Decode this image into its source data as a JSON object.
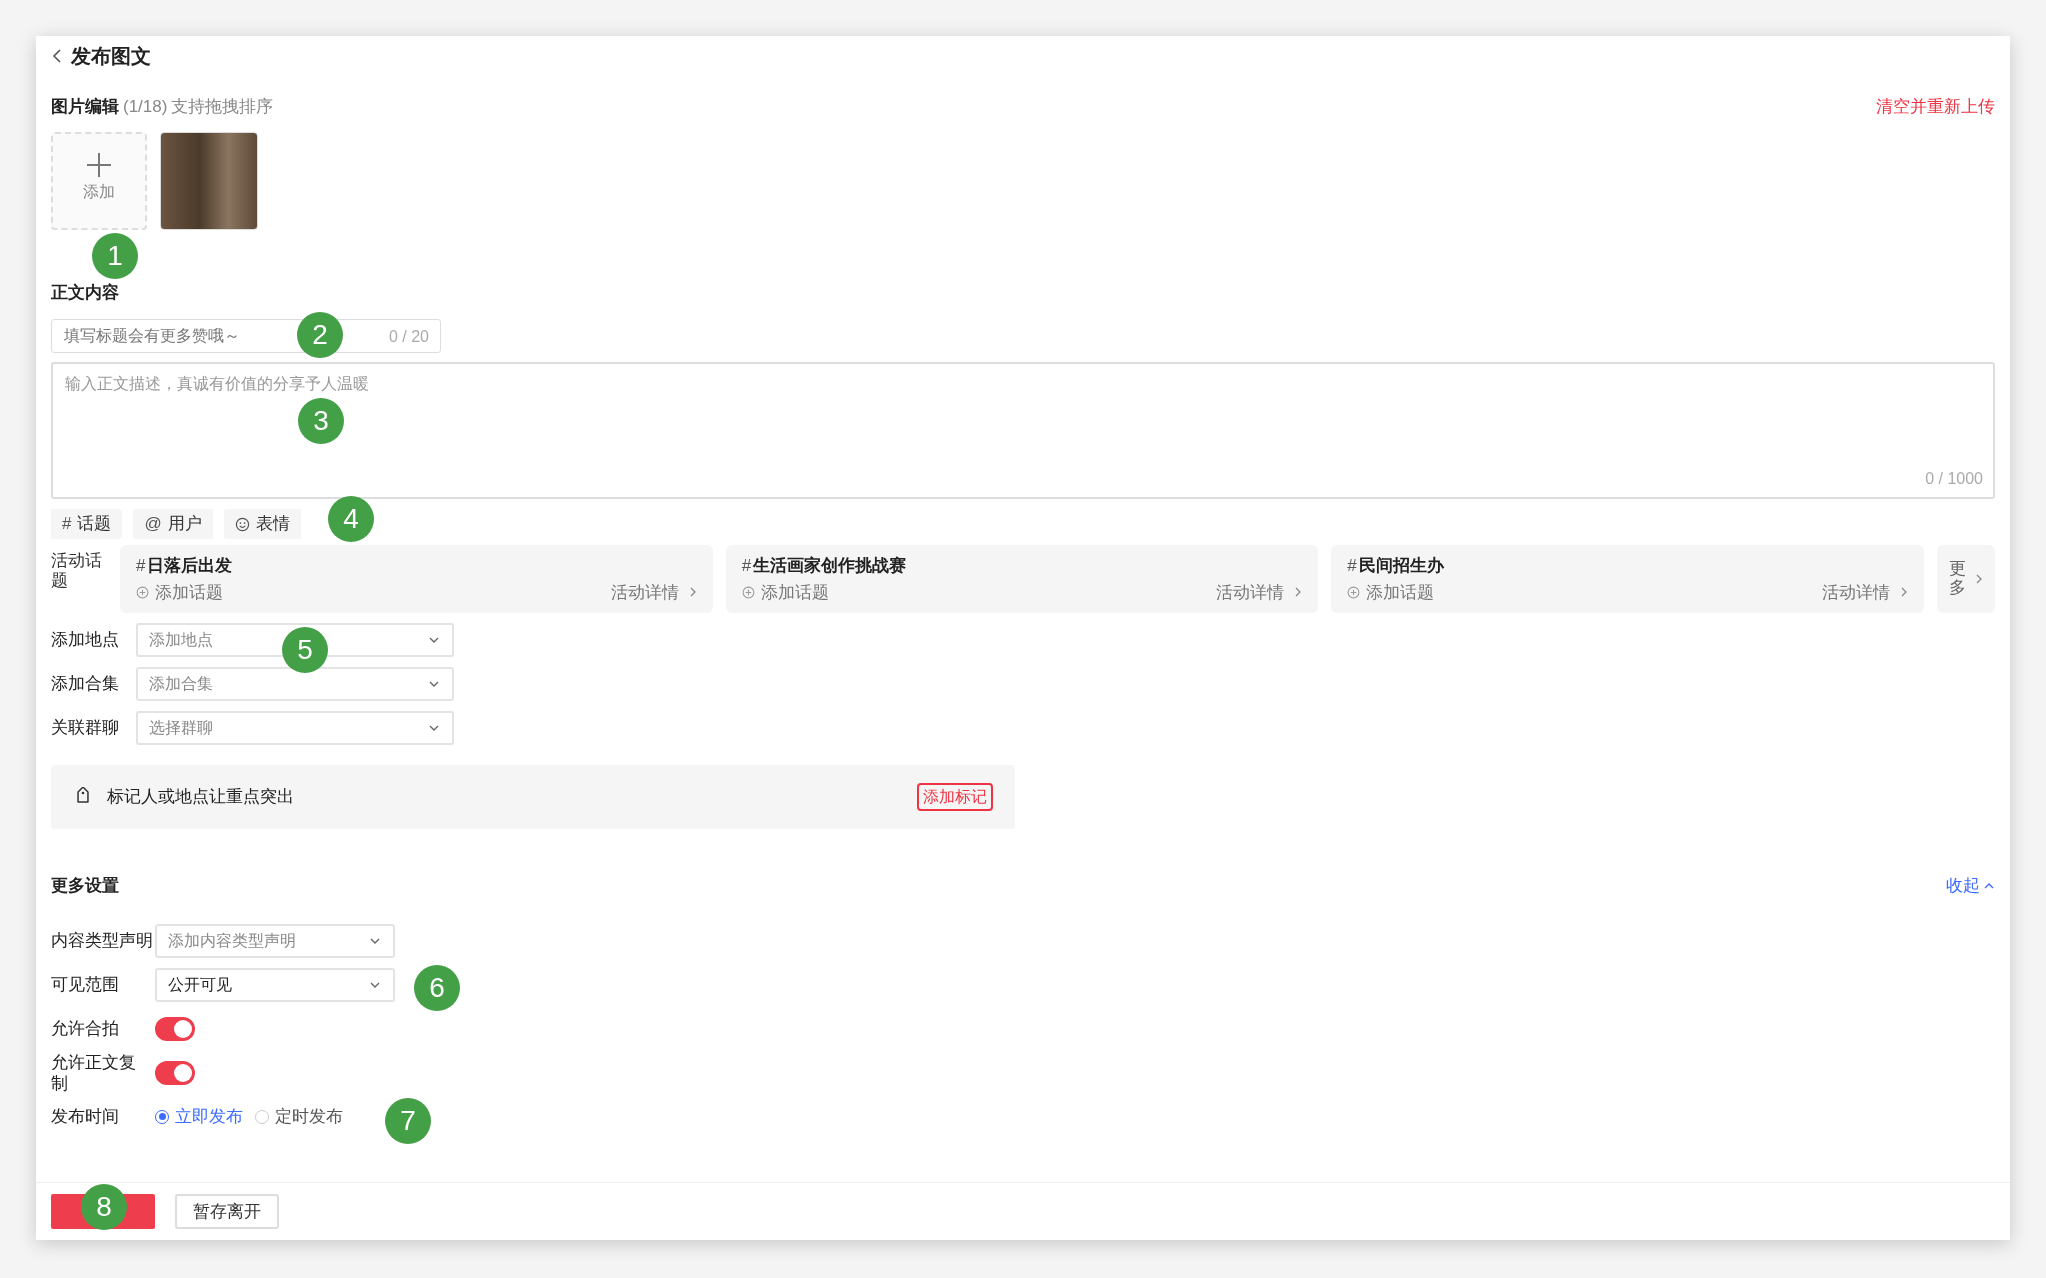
{
  "header": {
    "title": "发布图文"
  },
  "images": {
    "label": "图片编辑",
    "count": "(1/18)",
    "hint": "支持拖拽排序",
    "clear_link": "清空并重新上传",
    "add_label": "添加"
  },
  "body": {
    "label": "正文内容",
    "title_field": {
      "placeholder": "填写标题会有更多赞哦～",
      "counter": "0 / 20"
    },
    "text_field": {
      "placeholder": "输入正文描述，真诚有价值的分享予人温暖",
      "counter": "0 / 1000"
    },
    "chips": [
      {
        "kind": "symbol",
        "symbol": "#",
        "label": "话题"
      },
      {
        "kind": "symbol",
        "symbol": "@",
        "label": "用户"
      },
      {
        "kind": "emoji",
        "label": "表情"
      }
    ]
  },
  "activity": {
    "label": "活动话题",
    "topics": [
      {
        "hash": "#",
        "name": "日落后出发",
        "action": "添加话题",
        "details": "活动详情"
      },
      {
        "hash": "#",
        "name": "生活画家创作挑战赛",
        "action": "添加话题",
        "details": "活动详情"
      },
      {
        "hash": "#",
        "name": "民间招生办",
        "action": "添加话题",
        "details": "活动详情"
      }
    ],
    "more": "更多"
  },
  "selects": [
    {
      "label": "添加地点",
      "placeholder": "添加地点"
    },
    {
      "label": "添加合集",
      "placeholder": "添加合集"
    },
    {
      "label": "关联群聊",
      "placeholder": "选择群聊"
    }
  ],
  "mark_box": {
    "text": "标记人或地点让重点突出",
    "button": "添加标记"
  },
  "more_settings": {
    "title": "更多设置",
    "collapse": "收起",
    "rows": [
      {
        "kind": "select",
        "label": "内容类型声明",
        "placeholder": "添加内容类型声明"
      },
      {
        "kind": "select",
        "label": "可见范围",
        "value": "公开可见"
      },
      {
        "kind": "toggle",
        "label": "允许合拍",
        "on": true
      },
      {
        "kind": "toggle",
        "label": "允许正文复制",
        "on": true
      },
      {
        "kind": "radio",
        "label": "发布时间",
        "options": [
          {
            "label": "立即发布",
            "selected": true
          },
          {
            "label": "定时发布",
            "selected": false
          }
        ]
      }
    ]
  },
  "footer": {
    "secondary_button": "暂存离开"
  },
  "markers": [
    "1",
    "2",
    "3",
    "4",
    "5",
    "6",
    "7",
    "8"
  ]
}
